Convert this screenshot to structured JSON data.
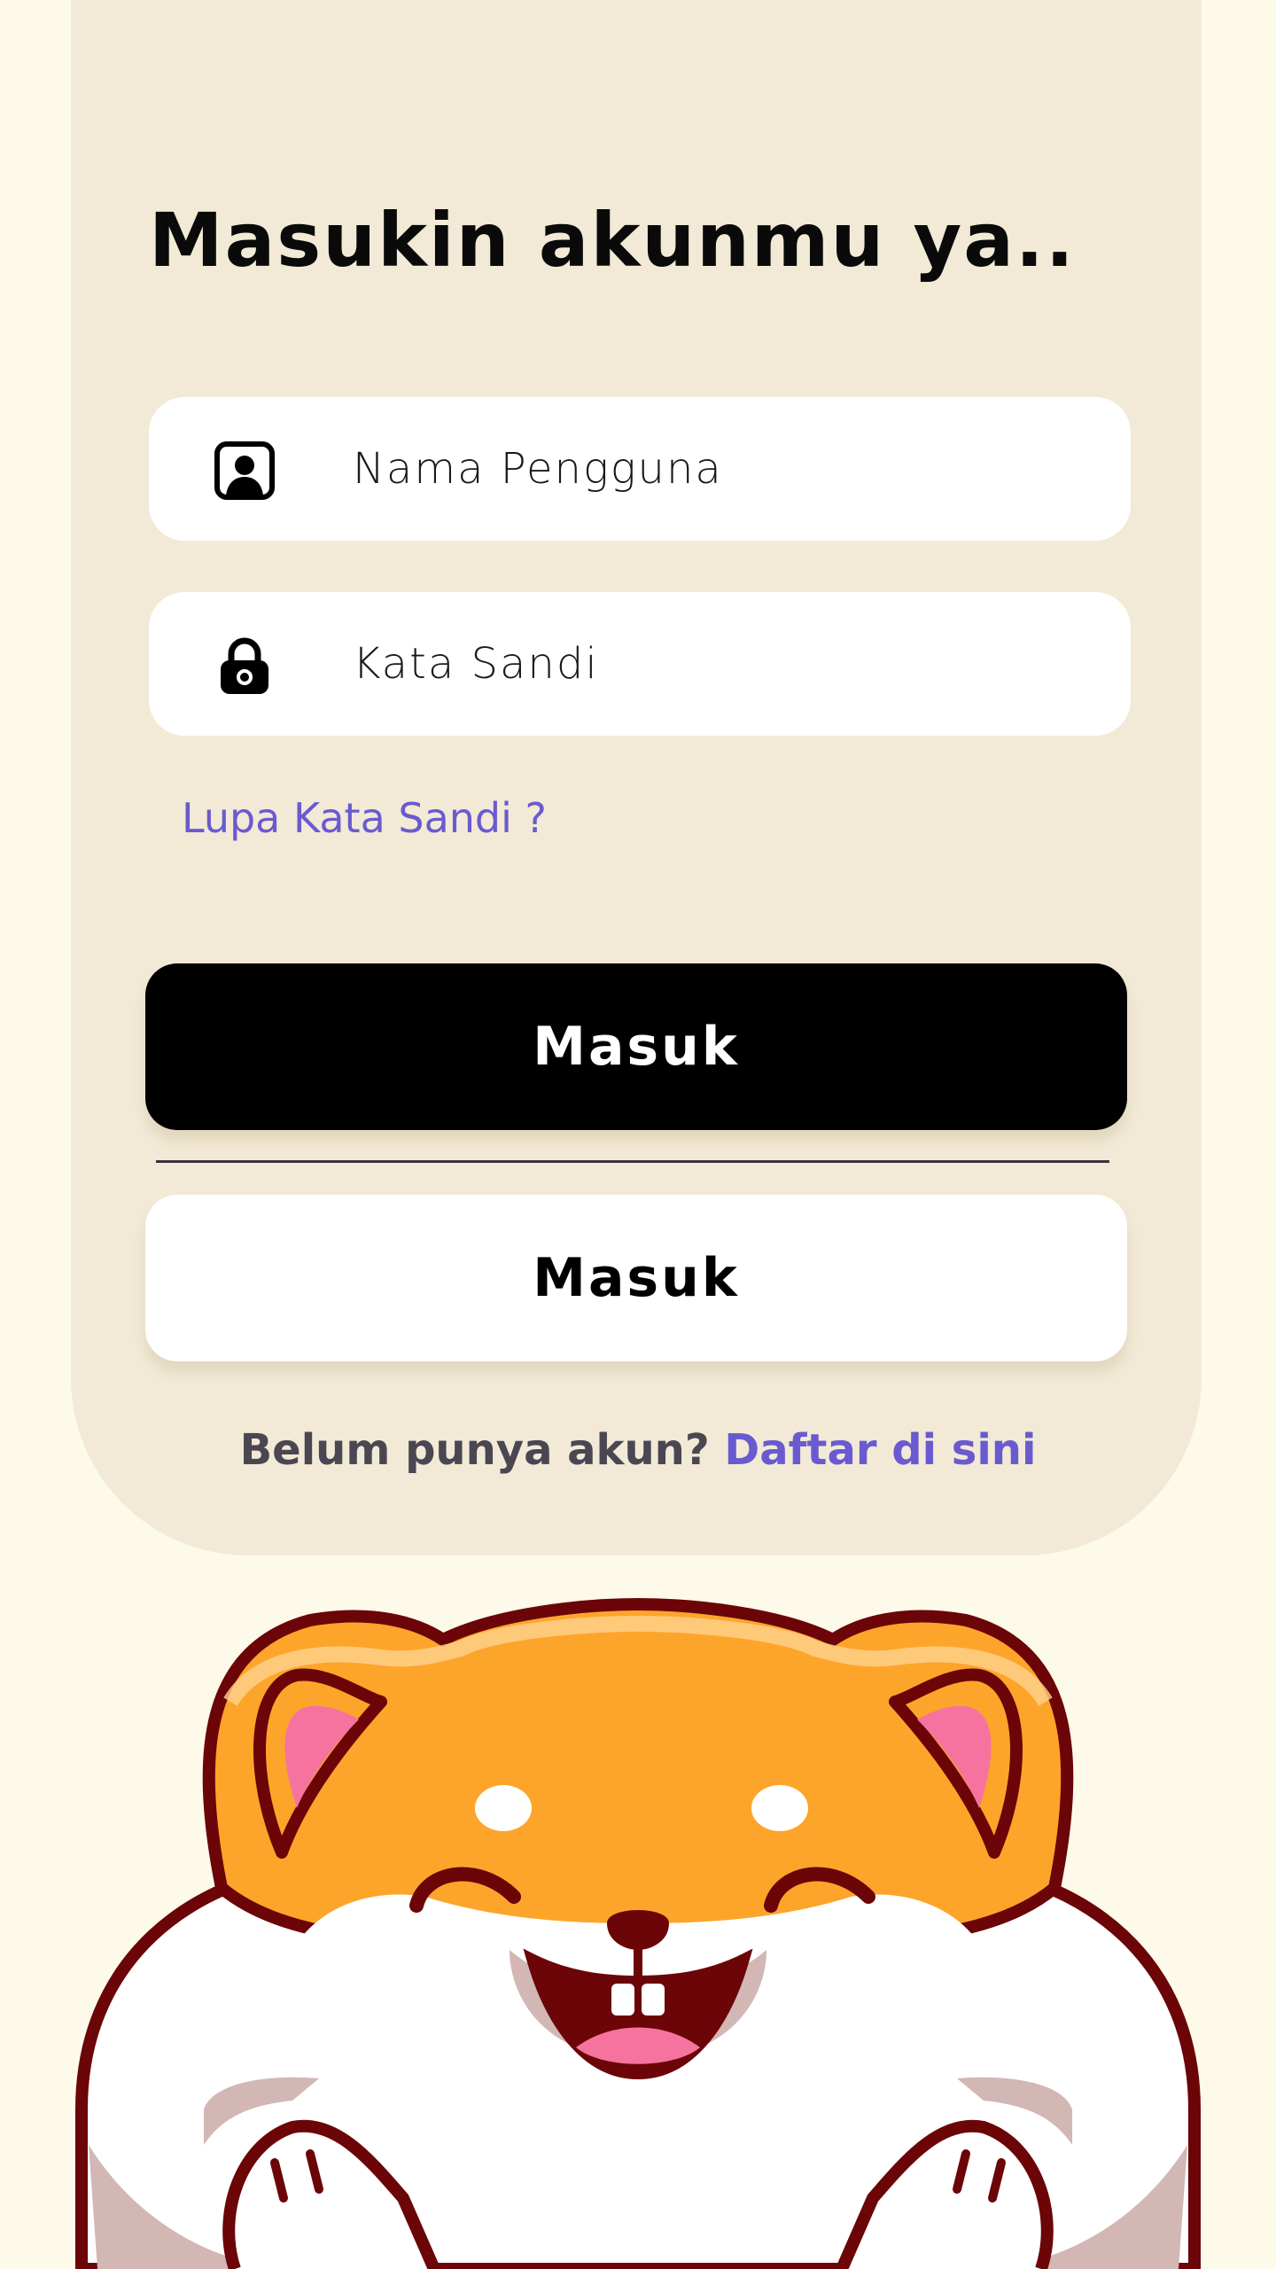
{
  "login": {
    "title": "Masukin akunmu ya..",
    "username": {
      "icon": "user-portrait-icon",
      "placeholder": "Nama Pengguna"
    },
    "password": {
      "icon": "lock-icon",
      "placeholder": "Kata Sandi"
    },
    "forgot_label": "Lupa Kata Sandi ?",
    "login_button_label": "Masuk",
    "alt_login_button_label": "Masuk",
    "signup_prompt": "Belum punya akun?",
    "signup_link": "Daftar di sini"
  },
  "mascot": {
    "name": "shiba-dog-illustration"
  },
  "colors": {
    "background": "#fefae9",
    "card": "#f2ead6",
    "accent": "#6a5ad0",
    "primary_button": "#000000",
    "text": "#0a0a0a"
  }
}
